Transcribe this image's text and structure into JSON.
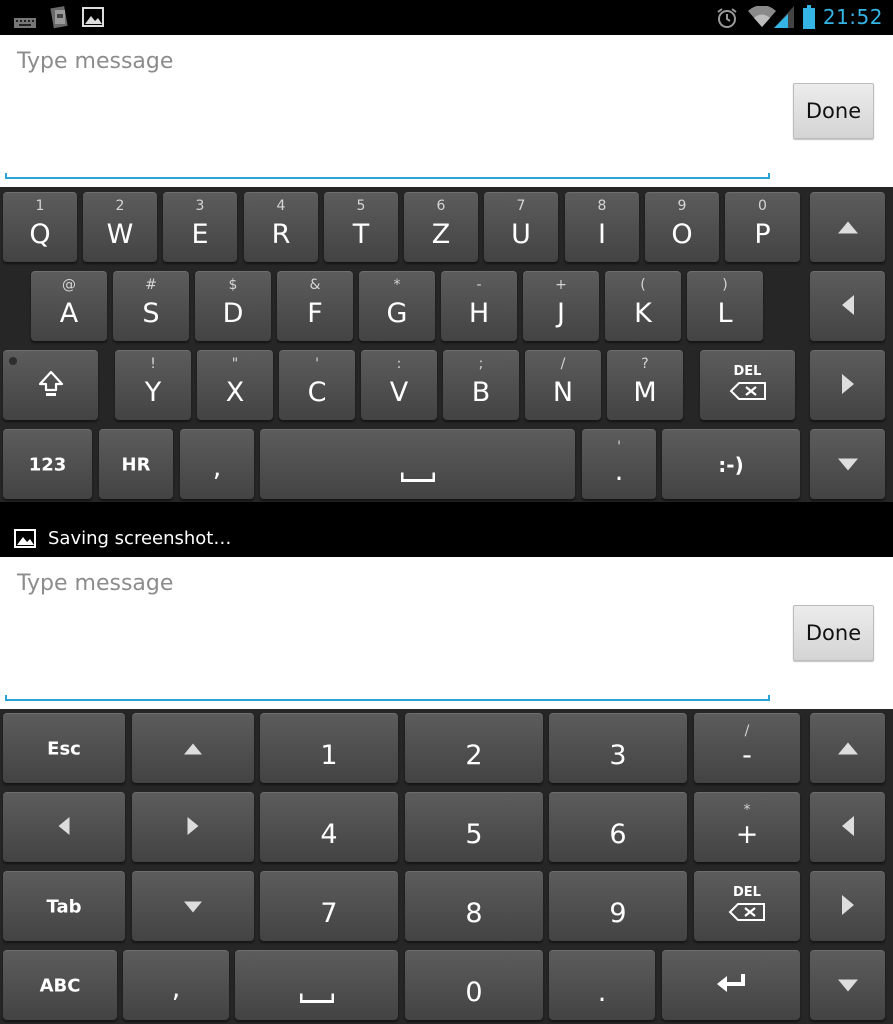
{
  "status_bar": {
    "time": "21:52"
  },
  "editor_top": {
    "placeholder": "Type message",
    "done_label": "Done"
  },
  "editor_bottom": {
    "placeholder": "Type message",
    "done_label": "Done"
  },
  "keyboard_qwertz": {
    "row1": [
      {
        "main": "Q",
        "sup": "1"
      },
      {
        "main": "W",
        "sup": "2"
      },
      {
        "main": "E",
        "sup": "3"
      },
      {
        "main": "R",
        "sup": "4"
      },
      {
        "main": "T",
        "sup": "5"
      },
      {
        "main": "Z",
        "sup": "6"
      },
      {
        "main": "U",
        "sup": "7"
      },
      {
        "main": "I",
        "sup": "8"
      },
      {
        "main": "O",
        "sup": "9"
      },
      {
        "main": "P",
        "sup": "0"
      }
    ],
    "row2": [
      {
        "main": "A",
        "sup": "@"
      },
      {
        "main": "S",
        "sup": "#"
      },
      {
        "main": "D",
        "sup": "$"
      },
      {
        "main": "F",
        "sup": "&"
      },
      {
        "main": "G",
        "sup": "*"
      },
      {
        "main": "H",
        "sup": "-"
      },
      {
        "main": "J",
        "sup": "+"
      },
      {
        "main": "K",
        "sup": "("
      },
      {
        "main": "L",
        "sup": ")"
      }
    ],
    "row3": [
      {
        "main": "Y",
        "sup": "!"
      },
      {
        "main": "X",
        "sup": "\""
      },
      {
        "main": "C",
        "sup": "'"
      },
      {
        "main": "V",
        "sup": ":"
      },
      {
        "main": "B",
        "sup": ";"
      },
      {
        "main": "N",
        "sup": "/"
      },
      {
        "main": "M",
        "sup": "?"
      }
    ],
    "del_label": "DEL",
    "num_label": "123",
    "lang_label": "HR",
    "comma_label": ",",
    "period_label": ".",
    "period_sup": "'",
    "smiley_label": ":-)"
  },
  "toast": {
    "text": "Saving screenshot…"
  },
  "keyboard_numpad": {
    "esc_label": "Esc",
    "tab_label": "Tab",
    "abc_label": "ABC",
    "digits": [
      "1",
      "2",
      "3",
      "4",
      "5",
      "6",
      "7",
      "8",
      "9",
      "0"
    ],
    "minus_label": "-",
    "minus_sup": "/",
    "plus_label": "+",
    "plus_sup": "*",
    "del_label": "DEL",
    "comma_label": ",",
    "period_label": "."
  }
}
